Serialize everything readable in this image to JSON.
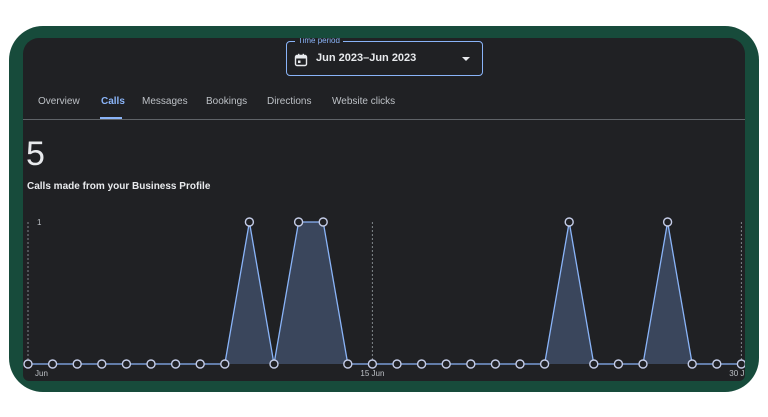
{
  "time_period": {
    "label": "Time period",
    "value": "Jun 2023–Jun 2023"
  },
  "tabs": [
    {
      "label": "Overview",
      "active": false
    },
    {
      "label": "Calls",
      "active": true
    },
    {
      "label": "Messages",
      "active": false
    },
    {
      "label": "Bookings",
      "active": false
    },
    {
      "label": "Directions",
      "active": false
    },
    {
      "label": "Website clicks",
      "active": false
    }
  ],
  "metric": {
    "value": "5",
    "label": "Calls made from your Business Profile"
  },
  "colors": {
    "accent": "#8ab4f8",
    "background": "#202124",
    "frame": "#174b3b",
    "area_fill": "#3d4a63"
  },
  "chart_data": {
    "type": "area",
    "x": [
      1,
      2,
      3,
      4,
      5,
      6,
      7,
      8,
      9,
      10,
      11,
      12,
      13,
      14,
      15,
      16,
      17,
      18,
      19,
      20,
      21,
      22,
      23,
      24,
      25,
      26,
      27,
      28,
      29,
      30
    ],
    "series": [
      {
        "values": [
          0,
          0,
          0,
          0,
          0,
          0,
          0,
          0,
          0,
          1,
          0,
          1,
          1,
          0,
          0,
          0,
          0,
          0,
          0,
          0,
          0,
          0,
          1,
          0,
          0,
          0,
          1,
          0,
          0,
          0
        ]
      }
    ],
    "ylim": [
      0,
      1
    ],
    "y_ticks": [
      "1"
    ],
    "x_tick_labels": [
      {
        "day": 1,
        "label": "Jun"
      },
      {
        "day": 15,
        "label": "15 Jun"
      },
      {
        "day": 30,
        "label": "30 J"
      }
    ]
  }
}
